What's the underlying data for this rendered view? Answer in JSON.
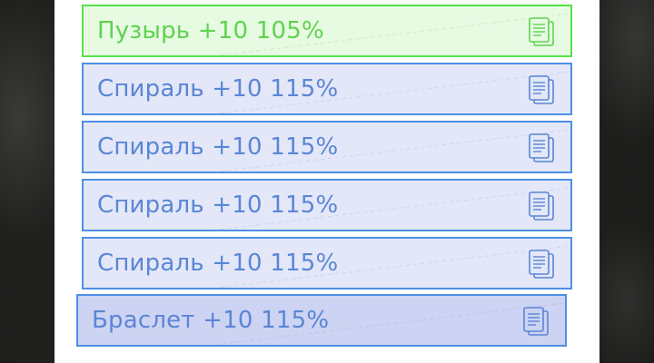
{
  "items": [
    {
      "label": "Пузырь +10 105%",
      "icon": "copy-icon",
      "state": "selected"
    },
    {
      "label": "Спираль +10 115%",
      "icon": "copy-icon",
      "state": "normal"
    },
    {
      "label": "Спираль +10 115%",
      "icon": "copy-icon",
      "state": "normal"
    },
    {
      "label": "Спираль +10 115%",
      "icon": "copy-icon",
      "state": "normal"
    },
    {
      "label": "Спираль +10 115%",
      "icon": "copy-icon",
      "state": "normal"
    },
    {
      "label": "Браслет +10 115%",
      "icon": "copy-icon",
      "state": "dragging"
    }
  ],
  "colors": {
    "selected_border": "#55e34a",
    "selected_text": "#5fd34f",
    "item_border": "#4d8fe6",
    "item_text": "#5a86d6",
    "item_bg": "#e3e7f8"
  }
}
